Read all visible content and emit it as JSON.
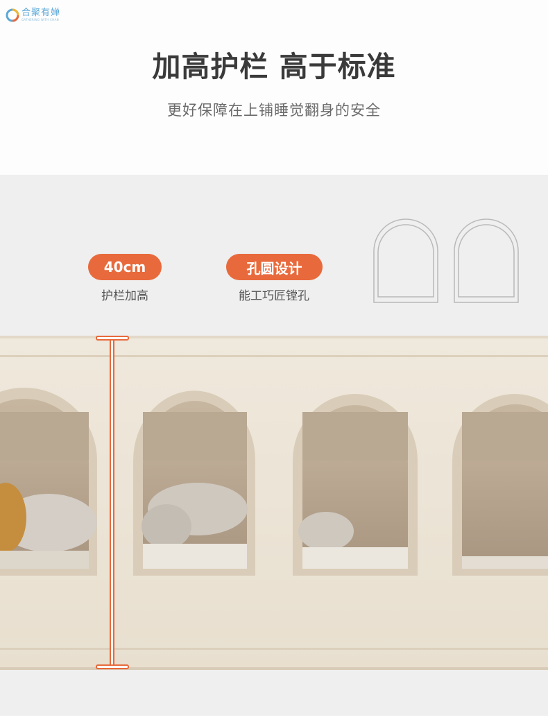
{
  "brand": {
    "name": "合聚有婵",
    "tagline": "GATHERING WITH CHAN"
  },
  "header": {
    "title": "加高护栏 高于标准",
    "subtitle": "更好保障在上铺睡觉翻身的安全"
  },
  "features": [
    {
      "badge": "40cm",
      "text": "护栏加高"
    },
    {
      "badge": "孔圆设计",
      "text": "能工巧匠镗孔"
    }
  ],
  "colors": {
    "accent": "#e86a3c",
    "panel": "#ece4d6",
    "background": "#efefef"
  },
  "icons": [
    "arch-outline-icon",
    "arch-outline-icon"
  ]
}
